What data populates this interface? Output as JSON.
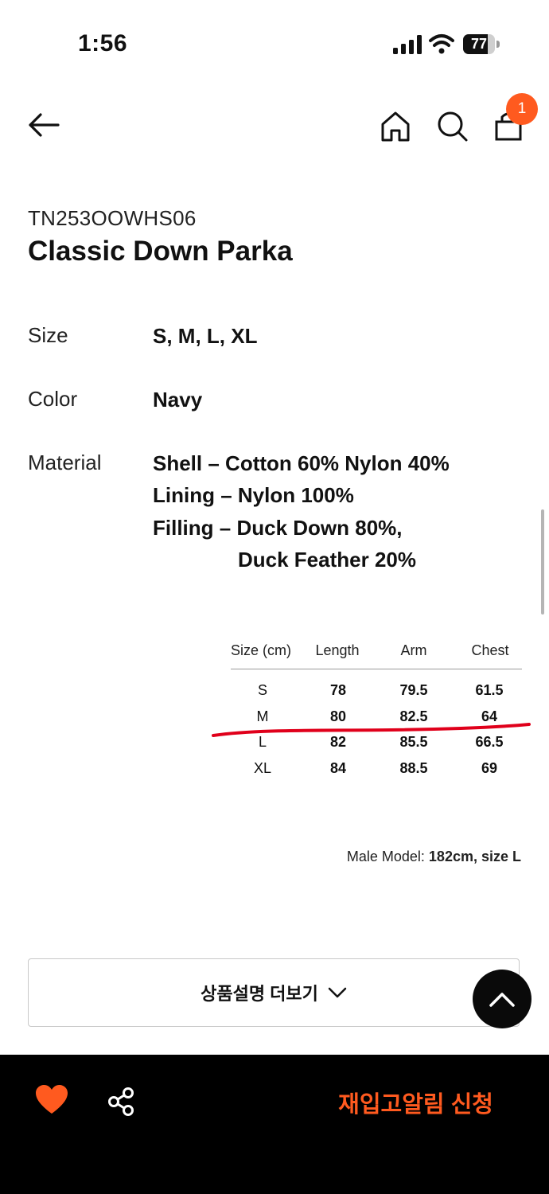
{
  "status_bar": {
    "time": "1:56",
    "battery": "77",
    "battery_level": 0.77
  },
  "nav": {
    "cart_count": "1"
  },
  "product": {
    "code": "TN253OOWHS06",
    "name": "Classic Down Parka"
  },
  "specs": {
    "size_label": "Size",
    "size_value": "S, M, L, XL",
    "color_label": "Color",
    "color_value": "Navy",
    "material_label": "Material",
    "material_lines": [
      "Shell – Cotton 60% Nylon 40%",
      "Lining – Nylon 100%",
      "Filling – Duck Down 80%,",
      "Duck Feather 20%"
    ]
  },
  "size_table": {
    "headers": [
      "Size (cm)",
      "Length",
      "Arm",
      "Chest"
    ],
    "rows": [
      [
        "S",
        "78",
        "79.5",
        "61.5"
      ],
      [
        "M",
        "80",
        "82.5",
        "64"
      ],
      [
        "L",
        "82",
        "85.5",
        "66.5"
      ],
      [
        "XL",
        "84",
        "88.5",
        "69"
      ]
    ]
  },
  "model_note": {
    "prefix": "Male Model:",
    "detail": "182cm, size L"
  },
  "more_button": {
    "label": "상품설명 더보기"
  },
  "footer": {
    "restock_label": "재입고알림 신청"
  },
  "colors": {
    "accent": "#ff5a1f",
    "annotation_red": "#e0001b",
    "footer_bg": "#000000"
  },
  "icons": {
    "back": "arrow-left-icon",
    "home": "home-icon",
    "search": "search-icon",
    "cart": "shopping-bag-icon",
    "like": "heart-icon",
    "share": "share-icon",
    "scroll_top": "chevron-up-icon",
    "expand": "chevron-down-icon"
  }
}
